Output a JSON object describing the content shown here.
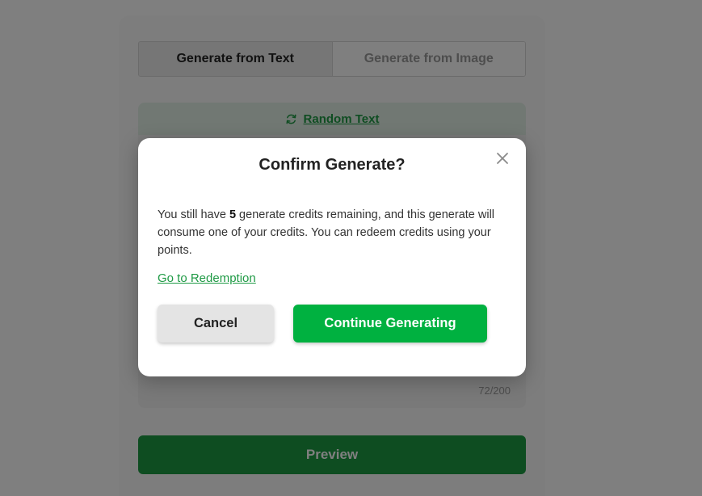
{
  "tabs": [
    {
      "label": "Generate from Text",
      "active": true
    },
    {
      "label": "Generate from Image",
      "active": false
    }
  ],
  "random_text": {
    "label": "Random Text",
    "icon": "refresh-icon"
  },
  "textarea": {
    "char_count": "72/200"
  },
  "preview_button": {
    "label": "Preview"
  },
  "modal": {
    "title": "Confirm Generate?",
    "body_prefix": "You still have ",
    "credits": "5",
    "body_suffix": " generate credits remaining, and this generate will consume one of your credits. You can redeem credits using your points.",
    "redeem_link": "Go to Redemption",
    "cancel_label": "Cancel",
    "continue_label": "Continue Generating",
    "close_icon": "close-icon"
  },
  "colors": {
    "accent_green": "#00b140",
    "link_green": "#1f9a45",
    "preview_green": "#1c9b42"
  }
}
